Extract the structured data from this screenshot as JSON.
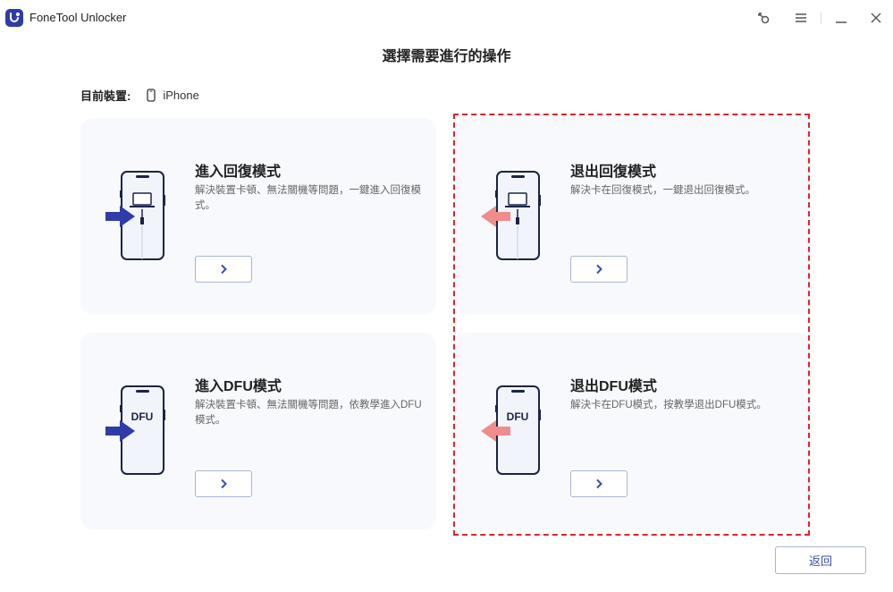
{
  "app": {
    "title": "FoneTool Unlocker"
  },
  "window_controls": {
    "icons": [
      "key-icon",
      "menu-icon",
      "minimize-icon",
      "close-icon"
    ]
  },
  "page": {
    "title": "選擇需要進行的操作",
    "device_label": "目前裝置:",
    "device_name": "iPhone"
  },
  "cards": [
    {
      "title": "進入回復模式",
      "desc": "解決裝置卡頓、無法關機等問題，一鍵進入回復模式。",
      "illustration": "laptop",
      "direction": "in"
    },
    {
      "title": "退出回復模式",
      "desc": "解決卡在回復模式，一鍵退出回復模式。",
      "illustration": "laptop",
      "direction": "out"
    },
    {
      "title": "進入DFU模式",
      "desc": "解決裝置卡頓、無法關機等問題，依教學進入DFU模式。",
      "illustration": "DFU",
      "direction": "in"
    },
    {
      "title": "退出DFU模式",
      "desc": "解決卡在DFU模式，按教學退出DFU模式。",
      "illustration": "DFU",
      "direction": "out"
    }
  ],
  "footer": {
    "back_label": "返回"
  },
  "colors": {
    "accent": "#2f3ca8",
    "arrow_in": "#2f3ca8",
    "arrow_out": "#f08c8c",
    "highlight": "#e0242a",
    "card_bg": "#f7f9fc"
  }
}
